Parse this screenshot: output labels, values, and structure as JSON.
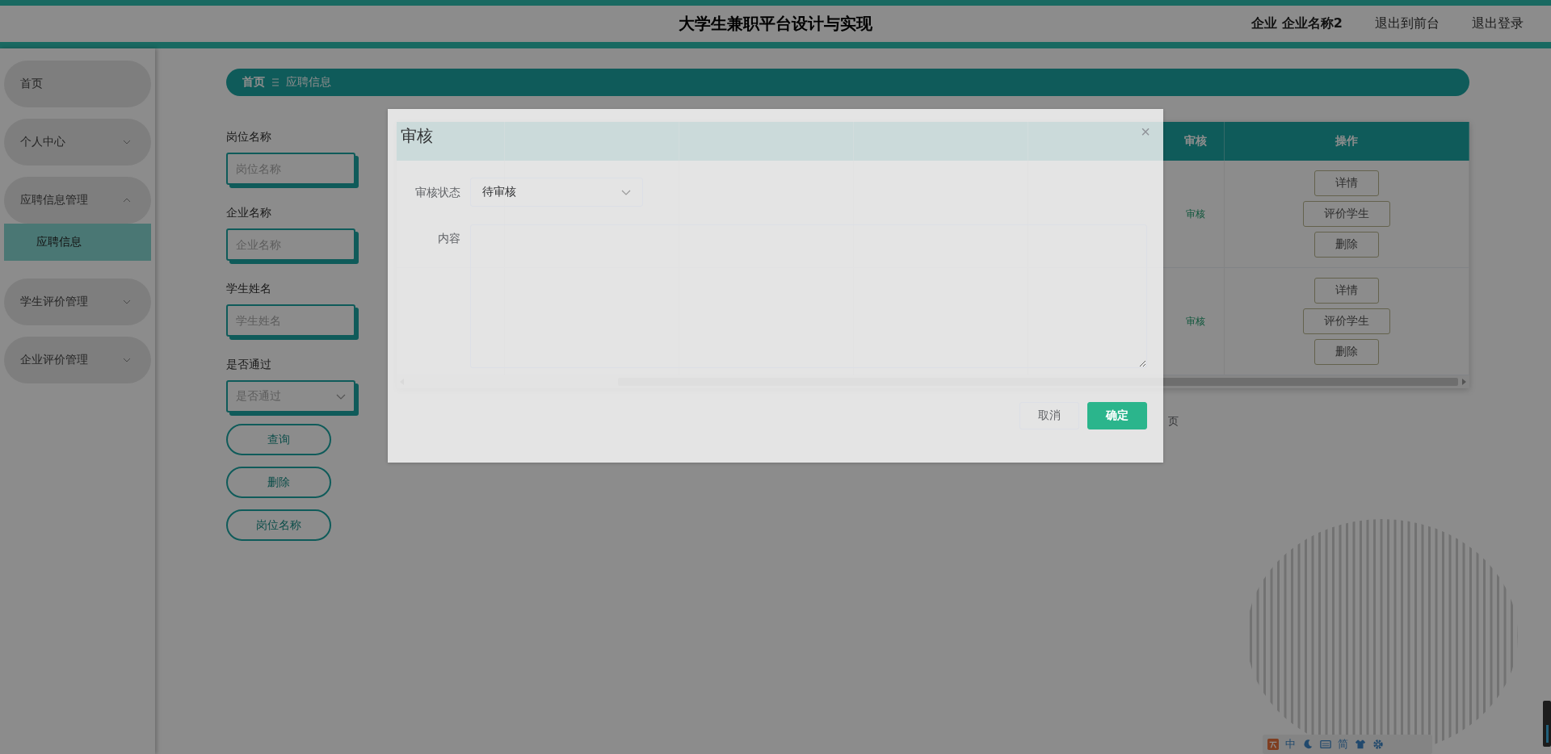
{
  "header": {
    "title": "大学生兼职平台设计与实现",
    "user": "企业 企业名称2",
    "links": [
      "退出到前台",
      "退出登录"
    ]
  },
  "sidebar": {
    "items": [
      {
        "label": "首页",
        "kind": "link"
      },
      {
        "label": "个人中心",
        "kind": "group",
        "expanded": false
      },
      {
        "label": "应聘信息管理",
        "kind": "group",
        "expanded": true,
        "children": [
          {
            "label": "应聘信息",
            "selected": true
          }
        ]
      },
      {
        "label": "学生评价管理",
        "kind": "group",
        "expanded": false
      },
      {
        "label": "企业评价管理",
        "kind": "group",
        "expanded": false
      }
    ]
  },
  "breadcrumb": [
    "首页",
    "应聘信息"
  ],
  "search": {
    "fields": [
      {
        "label": "岗位名称",
        "placeholder": "岗位名称",
        "kind": "input"
      },
      {
        "label": "企业名称",
        "placeholder": "企业名称",
        "kind": "input"
      },
      {
        "label": "学生姓名",
        "placeholder": "学生姓名",
        "kind": "input"
      },
      {
        "label": "是否通过",
        "placeholder": "是否通过",
        "kind": "select"
      }
    ],
    "buttons": [
      "查询",
      "删除",
      "岗位名称"
    ]
  },
  "table": {
    "columns": [
      "审核",
      "操作"
    ],
    "rows": [
      {
        "review": "审核",
        "actions": [
          "详情",
          "评价学生",
          "删除"
        ]
      },
      {
        "review": "审核",
        "actions": [
          "详情",
          "评价学生",
          "删除"
        ]
      }
    ]
  },
  "pagination": {
    "goto_suffix": "页"
  },
  "dialog": {
    "title": "审核",
    "close": "×",
    "fields": [
      {
        "label": "审核状态",
        "kind": "select",
        "value": "待审核"
      },
      {
        "label": "内容",
        "kind": "textarea"
      }
    ],
    "buttons": [
      {
        "label": "取消",
        "kind": "default"
      },
      {
        "label": "确定",
        "kind": "primary"
      }
    ]
  },
  "ime_bar": {
    "mode": "中",
    "script": "简"
  }
}
